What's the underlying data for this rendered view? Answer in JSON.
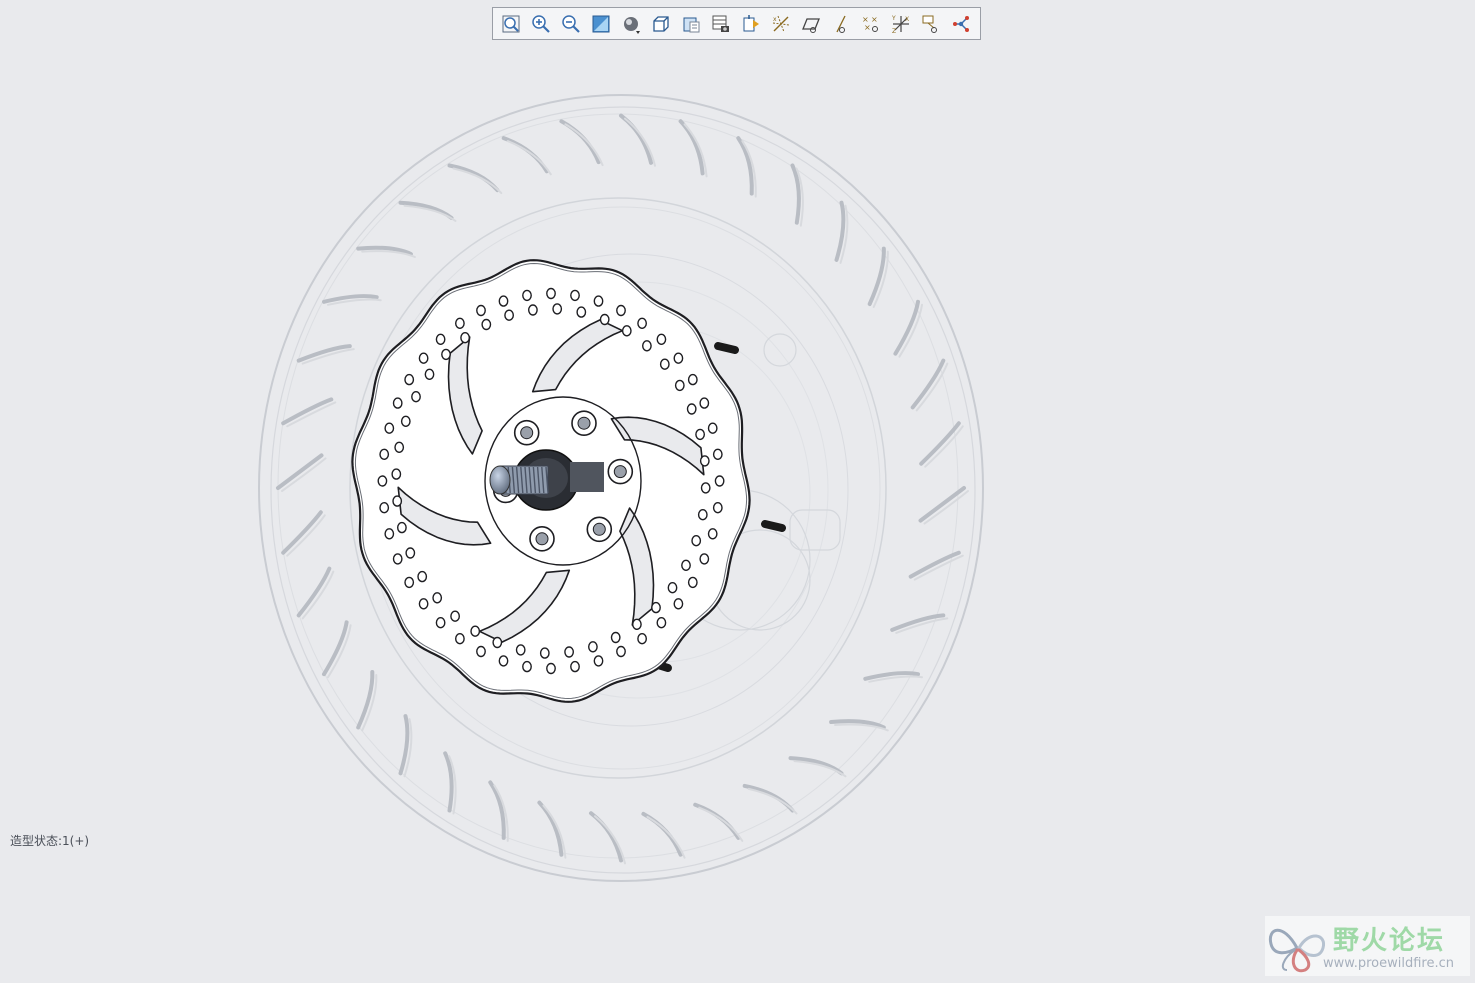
{
  "toolbar": {
    "buttons": [
      {
        "name": "refit-icon"
      },
      {
        "name": "zoom-in-icon"
      },
      {
        "name": "zoom-out-icon"
      },
      {
        "name": "repaint-icon"
      },
      {
        "name": "display-style-icon"
      },
      {
        "name": "saved-orientations-icon"
      },
      {
        "name": "view-manager-icon"
      },
      {
        "name": "layer-icon"
      },
      {
        "name": "perspective-icon"
      },
      {
        "name": "datum-planes-icon"
      },
      {
        "name": "datum-plane-display-icon"
      },
      {
        "name": "datum-axis-icon"
      },
      {
        "name": "datum-point-icon"
      },
      {
        "name": "csys-icon"
      },
      {
        "name": "annotation-icon"
      },
      {
        "name": "spin-center-icon"
      }
    ]
  },
  "status": {
    "model_state": "造型状态:1(+)"
  },
  "watermark": {
    "title": "野火论坛",
    "url": "www.proewildfire.cn"
  },
  "colors": {
    "background": "#e9eaed",
    "accent": "#3a6fb0"
  }
}
